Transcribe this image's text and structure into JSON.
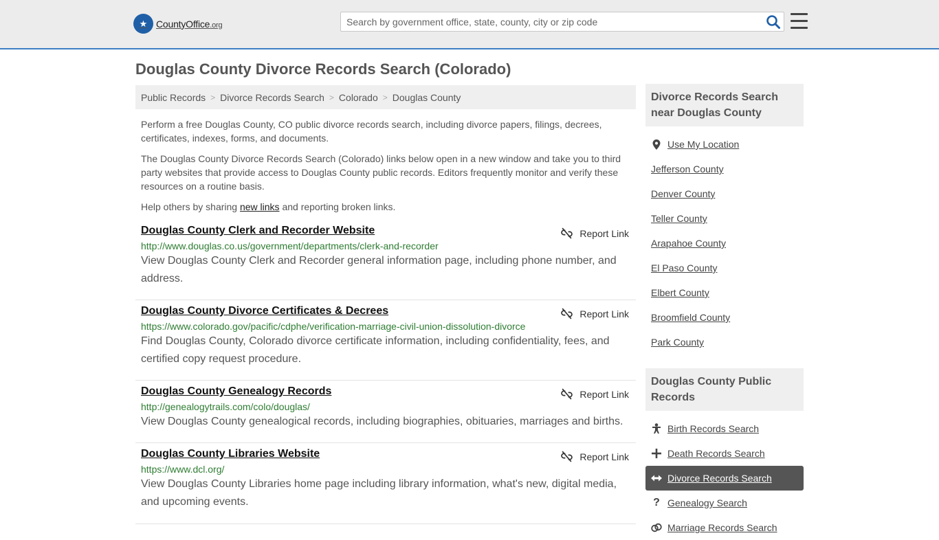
{
  "header": {
    "logo_name": "CountyOffice",
    "logo_tld": ".org",
    "search_placeholder": "Search by government office, state, county, city or zip code"
  },
  "page": {
    "title": "Douglas County Divorce Records Search (Colorado)"
  },
  "breadcrumb": [
    "Public Records",
    "Divorce Records Search",
    "Colorado",
    "Douglas County"
  ],
  "intro": {
    "p1": "Perform a free Douglas County, CO public divorce records search, including divorce papers, filings, decrees, certificates, indexes, forms, and documents.",
    "p2": "The Douglas County Divorce Records Search (Colorado) links below open in a new window and take you to third party websites that provide access to Douglas County public records. Editors frequently monitor and verify these resources on a routine basis.",
    "p3_before": "Help others by sharing ",
    "p3_link": "new links",
    "p3_after": " and reporting broken links."
  },
  "report_label": "Report Link",
  "results": [
    {
      "title": "Douglas County Clerk and Recorder Website",
      "url": "http://www.douglas.co.us/government/departments/clerk-and-recorder",
      "desc": "View Douglas County Clerk and Recorder general information page, including phone number, and address."
    },
    {
      "title": "Douglas County Divorce Certificates & Decrees",
      "url": "https://www.colorado.gov/pacific/cdphe/verification-marriage-civil-union-dissolution-divorce",
      "desc": "Find Douglas County, Colorado divorce certificate information, including confidentiality, fees, and certified copy request procedure."
    },
    {
      "title": "Douglas County Genealogy Records",
      "url": "http://genealogytrails.com/colo/douglas/",
      "desc": "View Douglas County genealogical records, including biographies, obituaries, marriages and births."
    },
    {
      "title": "Douglas County Libraries Website",
      "url": "https://www.dcl.org/",
      "desc": "View Douglas County Libraries home page including library information, what's new, digital media, and upcoming events."
    }
  ],
  "sidebar": {
    "nearby_heading": "Divorce Records Search near Douglas County",
    "use_location": "Use My Location",
    "nearby": [
      "Jefferson County",
      "Denver County",
      "Teller County",
      "Arapahoe County",
      "El Paso County",
      "Elbert County",
      "Broomfield County",
      "Park County"
    ],
    "public_heading": "Douglas County Public Records",
    "public_records": [
      {
        "label": "Birth Records Search",
        "icon": "baby-icon",
        "active": false
      },
      {
        "label": "Death Records Search",
        "icon": "cross-icon",
        "active": false
      },
      {
        "label": "Divorce Records Search",
        "icon": "arrows-horizontal-icon",
        "active": true
      },
      {
        "label": "Genealogy Search",
        "icon": "question-icon",
        "active": false
      },
      {
        "label": "Marriage Records Search",
        "icon": "rings-icon",
        "active": false
      }
    ]
  },
  "colors": {
    "header_bg": "#ececec",
    "header_border": "#3b7fc4",
    "logo_blue": "#1f5fa7",
    "url_green": "#2e7d32",
    "active_bg": "#555555"
  }
}
